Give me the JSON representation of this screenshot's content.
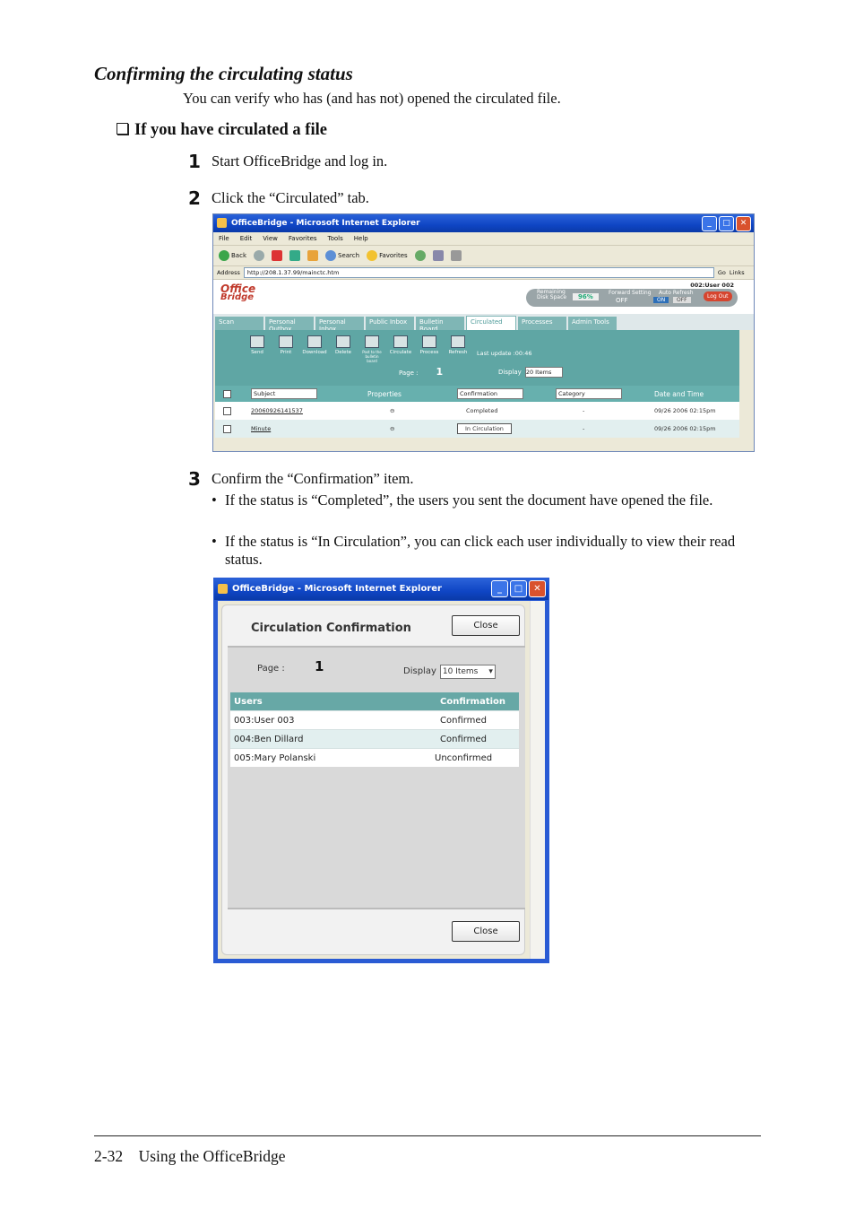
{
  "section_title": "Confirming the circulating status",
  "intro": "You can verify who has (and has not) opened the circulated file.",
  "subheading": "If you have circulated a file",
  "steps": [
    {
      "num": "1",
      "text": "Start OfficeBridge and log in."
    },
    {
      "num": "2",
      "text": "Click the “Circulated” tab."
    },
    {
      "num": "3",
      "text": "Confirm the “Confirmation” item."
    }
  ],
  "bullets": [
    "If the status is “Completed”, the users you sent the document have opened the file.",
    "If the status is “In Circulation”, you can click each user individually to view their read status."
  ],
  "screenshot1": {
    "window_title": "OfficeBridge - Microsoft Internet Explorer",
    "menu": [
      "File",
      "Edit",
      "View",
      "Favorites",
      "Tools",
      "Help"
    ],
    "toolbar": [
      "Back",
      "Search",
      "Favorites"
    ],
    "address_label": "Address",
    "address": "http://208.1.37.99/mainctc.htm",
    "go": "Go",
    "links": "Links",
    "logo_top": "Office",
    "logo_bottom": "Bridge",
    "user": "002:User 002",
    "remaining": "Remaining Disk Space",
    "disk": "96%",
    "forward": "Forward Setting",
    "off": "OFF",
    "auto_refresh": "Auto Refresh",
    "on": "ON",
    "off2": "OFF",
    "logout": "Log Out",
    "tabs": [
      "Scan",
      "Personal Outbox",
      "Personal Inbox",
      "Public Inbox",
      "Bulletin Board",
      "Circulated",
      "Processes",
      "Admin Tools"
    ],
    "icons": [
      "Send",
      "Print",
      "Download",
      "Delete",
      "Post to the bulletin board",
      "Circulate",
      "Process",
      "Refresh"
    ],
    "last_update": "Last update :00:46",
    "page_label": "Page :",
    "page_num": "1",
    "display_label": "Display",
    "display_value": "20 Items",
    "columns": {
      "subject": "Subject",
      "properties": "Properties",
      "confirmation": "Confirmation",
      "category": "Category",
      "date": "Date and Time"
    },
    "rows": [
      {
        "subject": "20060926141537",
        "confirmation": "Completed",
        "category": "-",
        "date": "09/26 2006 02:15pm"
      },
      {
        "subject": "Minute",
        "confirmation": "In Circulation",
        "category": "-",
        "date": "09/26 2006 02:15pm"
      }
    ]
  },
  "screenshot2": {
    "window_title": "OfficeBridge - Microsoft Internet Explorer",
    "title": "Circulation Confirmation",
    "close": "Close",
    "page_label": "Page :",
    "page_num": "1",
    "display_label": "Display",
    "display_value": "10 Items",
    "col_users": "Users",
    "col_confirmation": "Confirmation",
    "rows": [
      {
        "user": "003:User 003",
        "status": "Confirmed"
      },
      {
        "user": "004:Ben Dillard",
        "status": "Confirmed"
      },
      {
        "user": "005:Mary Polanski",
        "status": "Unconfirmed"
      }
    ]
  },
  "footer": "2-32    Using the OfficeBridge"
}
